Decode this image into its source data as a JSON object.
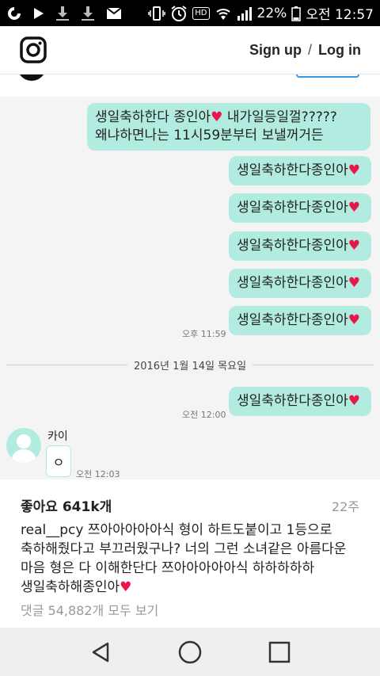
{
  "status_bar": {
    "battery": "22%",
    "time": "오전 12:57",
    "hd_label": "HD",
    "icons": [
      "carrier-logo-icon",
      "play-icon",
      "download-icon",
      "download-icon",
      "mail-icon",
      "vibrate-icon",
      "alarm-icon",
      "hd-icon",
      "wifi-icon",
      "signal-icon",
      "battery-icon"
    ]
  },
  "header": {
    "signup": "Sign up",
    "separator": "/",
    "login": "Log in"
  },
  "chat": {
    "messages": [
      {
        "line1": "생일축하한다 종인아",
        "line1b": " 내가일등일껄?????",
        "line2": "왜냐하면나는 11시59분부터 보낼꺼거든"
      },
      {
        "text": "생일축하한다종인아"
      },
      {
        "text": "생일축하한다종인아"
      },
      {
        "text": "생일축하한다종인아"
      },
      {
        "text": "생일축하한다종인아"
      },
      {
        "text": "생일축하한다종인아"
      },
      {
        "text": "생일축하한다종인아"
      }
    ],
    "heart_glyph": "♥",
    "time1": "오후 11:59",
    "date_divider": "2016년 1월 14일 목요일",
    "time2": "오전 12:00",
    "kai_name": "카이",
    "kai_message": "ㅇ",
    "kai_time": "오전 12:03"
  },
  "post": {
    "likes": "좋아요 641k개",
    "age": "22주",
    "username": "real__pcy",
    "caption": " 쯔아아아아아식 형이 하트도붙이고 1등으로 축하해줬다고 부끄러웠구나? 너의 그런 소녀같은 아름다운 마음 형은 다 이해한단다 쯔아아아아아식 하하하하하 생일축하해종인아",
    "heart_glyph": "♥",
    "comments": "댓글 54,882개 모두 보기"
  },
  "colors": {
    "bubble": "#b2ebdf",
    "heart": "#e8164b",
    "link_blue": "#3897f0"
  }
}
